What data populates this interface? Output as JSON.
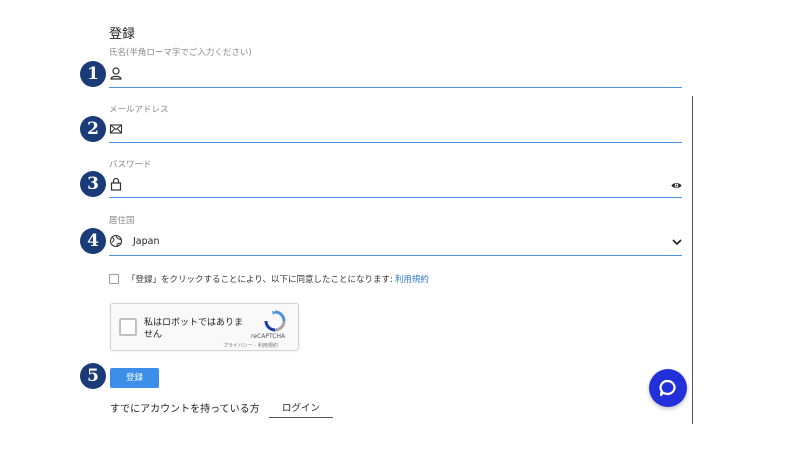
{
  "form": {
    "title": "登録",
    "steps": [
      "1",
      "2",
      "3",
      "4",
      "5"
    ],
    "name": {
      "label": "氏名(半角ローマ字でご入力ください)",
      "value": ""
    },
    "email": {
      "label": "メールアドレス",
      "value": ""
    },
    "password": {
      "label": "パスワード",
      "value": ""
    },
    "country": {
      "label": "居住国",
      "value": "Japan"
    },
    "terms": {
      "text": "「登録」をクリックすることにより、以下に同意したことになります:",
      "link": "利用規約"
    },
    "captcha": {
      "text": "私はロボットではありません",
      "brand": "reCAPTCHA",
      "links": "プライバシー - 利用規約"
    },
    "submit_label": "登録",
    "account_prompt": "すでにアカウントを持っている方",
    "login_label": "ログイン"
  },
  "colors": {
    "accent": "#4a90e2",
    "button": "#3d8ee8",
    "step_badge": "#1a3a78",
    "chat": "#2130d8",
    "link": "#2f78d3"
  },
  "icons": [
    "user-icon",
    "mail-icon",
    "lock-icon",
    "eye-icon",
    "globe-icon",
    "chevron-down-icon",
    "recaptcha-icon",
    "chat-icon"
  ]
}
